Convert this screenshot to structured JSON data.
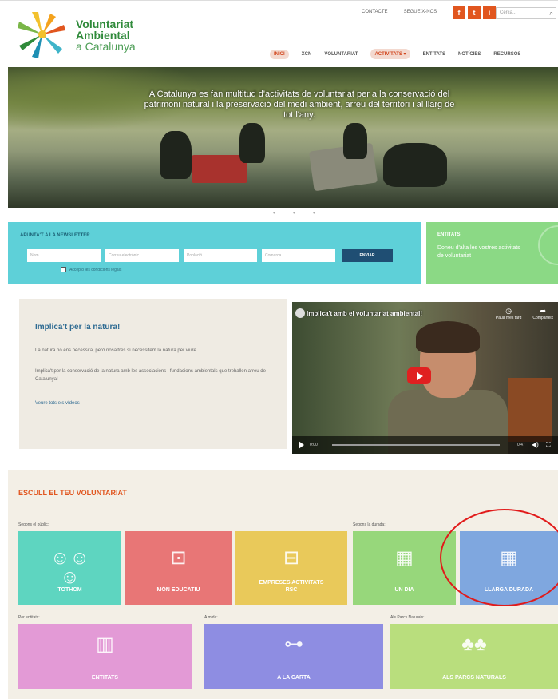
{
  "header": {
    "logo_lines": [
      "Voluntariat",
      "Ambiental",
      "a Catalunya"
    ],
    "top_links": [
      "CONTACTE",
      "SEGUEIX-NOS"
    ],
    "social": [
      "f",
      "t",
      "i"
    ],
    "search_placeholder": "Cerca...",
    "nav": [
      "INICI",
      "XCN",
      "VOLUNTARIAT",
      "ACTIVITATS ▾",
      "ENTITATS",
      "NOTÍCIES",
      "RECURSOS"
    ]
  },
  "hero": {
    "text": "A Catalunya es fan multitud d'activitats de voluntariat per a la conservació del patrimoni natural i la preservació del medi ambient, arreu del territori i al llarg de tot l'any.",
    "dots": "• • •"
  },
  "newsletter": {
    "title": "APUNTA'T A LA NEWSLETTER",
    "fields": [
      "Nom",
      "Correu electrònic",
      "Població",
      "Comarca"
    ],
    "button": "ENVIAR",
    "checkbox_label": "Accepto les condicions legals"
  },
  "entitats_box": {
    "title": "ENTITATS",
    "text": "Doneu d'alta les vostres activitats de voluntariat"
  },
  "implica": {
    "title": "Implica't per la natura!",
    "p1": "La natura no ens necessita, però nosaltres sí necessitem la natura per viure.",
    "p2": "Implica't per la conservació de la natura amb les associacions i fundacions ambientals que treballen arreu de Catalunya!",
    "link": "Veure tots els vídeos"
  },
  "video": {
    "title": "Implica't amb el voluntariat ambiental!",
    "watch_later": "Paua més tard",
    "share": "Comparteix",
    "time_start": "0:00",
    "time_end": "0:47"
  },
  "escull": {
    "title": "ESCULL EL TEU VOLUNTARIAT",
    "groups": [
      "Segons el públic:",
      "Segons la durada:",
      "Per entitats:",
      "A mida:",
      "Als Parcs Naturals:"
    ],
    "tiles": [
      {
        "label": "TOTHOM",
        "icon": "group-icon",
        "color": "#5ed5c0"
      },
      {
        "label": "MÓN EDUCATIU",
        "icon": "backpack-icon",
        "color": "#e87676"
      },
      {
        "label": "EMPRESES ACTIVITATS RSC",
        "icon": "briefcase-icon",
        "color": "#e9c95a"
      },
      {
        "label": "UN DIA",
        "icon": "calendar-icon",
        "color": "#97d77b"
      },
      {
        "label": "LLARGA DURADA",
        "icon": "calendar-icon",
        "color": "#7fa7df"
      },
      {
        "label": "ENTITATS",
        "icon": "buildings-icon",
        "color": "#e39ad6"
      },
      {
        "label": "A LA CARTA",
        "icon": "tape-measure-icon",
        "color": "#8e8de2"
      },
      {
        "label": "ALS PARCS NATURALS",
        "icon": "trees-icon",
        "color": "#b9de7d"
      }
    ]
  }
}
